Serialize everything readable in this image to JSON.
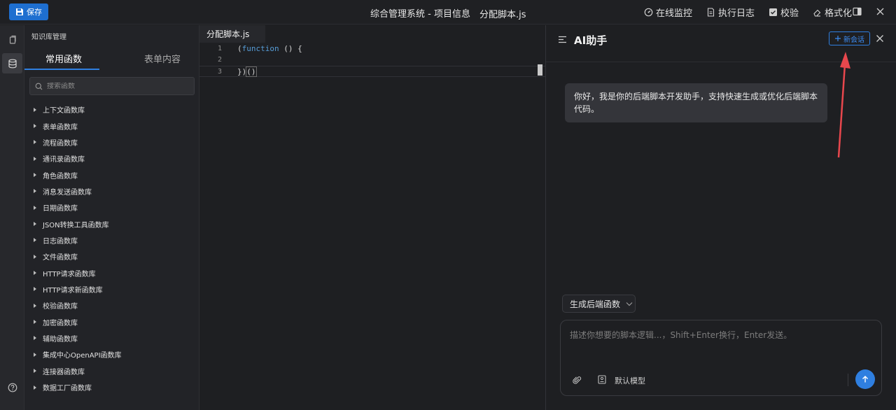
{
  "toolbar": {
    "save_label": "保存",
    "title": "综合管理系统 - 项目信息",
    "file_name": "分配脚本.js",
    "actions": [
      {
        "label": "在线监控",
        "icon": "monitor-icon"
      },
      {
        "label": "执行日志",
        "icon": "log-file-icon"
      },
      {
        "label": "校验",
        "icon": "checkbox-icon"
      },
      {
        "label": "格式化",
        "icon": "eraser-icon"
      }
    ]
  },
  "sidebar": {
    "title": "知识库管理",
    "tabs": [
      "常用函数",
      "表单内容"
    ],
    "active_tab": "常用函数",
    "search_placeholder": "搜索函数",
    "libraries": [
      "上下文函数库",
      "表单函数库",
      "流程函数库",
      "通讯录函数库",
      "角色函数库",
      "消息发送函数库",
      "日期函数库",
      "JSON转换工具函数库",
      "日志函数库",
      "文件函数库",
      "HTTP请求函数库",
      "HTTP请求新函数库",
      "校验函数库",
      "加密函数库",
      "辅助函数库",
      "集成中心OpenAPI函数库",
      "连接器函数库",
      "数据工厂函数库"
    ]
  },
  "editor": {
    "tab_label": "分配脚本.js",
    "lines": [
      {
        "num": "1",
        "text": "(function () {"
      },
      {
        "num": "2",
        "text": ""
      },
      {
        "num": "3",
        "text": "})()"
      }
    ]
  },
  "ai_panel": {
    "title": "AI助手",
    "new_chat_label": "新会话",
    "greeting": "你好，我是你的后端脚本开发助手，支持快速生成或优化后端脚本代码。",
    "mode_label": "生成后端函数",
    "input_placeholder": "描述你想要的脚本逻辑...，Shift+Enter换行，Enter发送。",
    "model_label": "默认模型"
  },
  "colors": {
    "accent": "#2f7fe0",
    "annotation_arrow": "#e8474d",
    "keyword": "#569cd6"
  }
}
